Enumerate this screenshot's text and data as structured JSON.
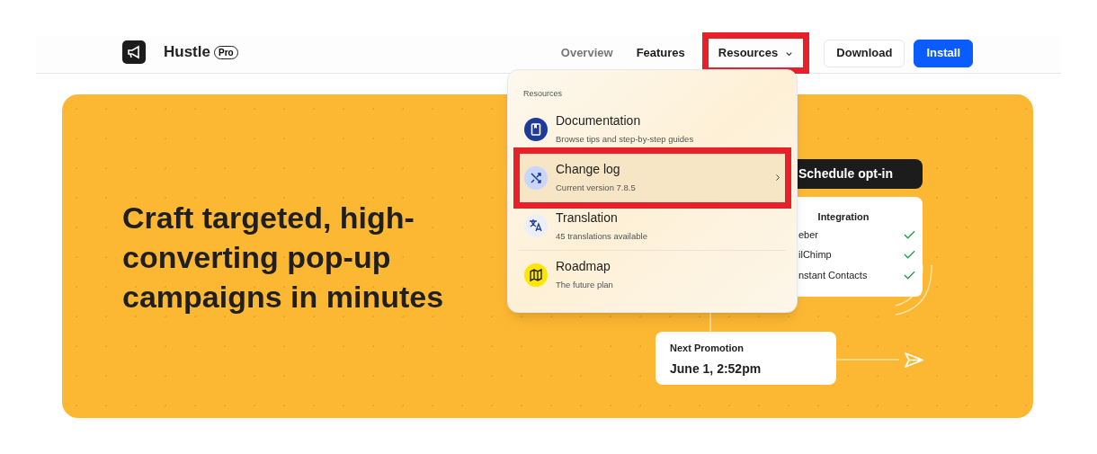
{
  "brand": {
    "name": "Hustle",
    "badge": "Pro"
  },
  "nav": [
    {
      "label": "Overview",
      "selected": false,
      "highlighted": false,
      "dropdown": false
    },
    {
      "label": "Features",
      "selected": true,
      "highlighted": false,
      "dropdown": false
    },
    {
      "label": "Resources",
      "selected": true,
      "highlighted": true,
      "dropdown": true
    }
  ],
  "buttons": [
    {
      "label": "Download",
      "kind": "outline"
    },
    {
      "label": "Install",
      "kind": "primary"
    }
  ],
  "hero": {
    "headline": "Craft targeted, high-converting pop-up campaigns in minutes"
  },
  "menu": {
    "heading": "Resources",
    "items": [
      {
        "kind": "book",
        "title": "Documentation",
        "subtitle": "Browse tips and step-by-step guides",
        "highlighted": false,
        "arrow": false,
        "divider": false
      },
      {
        "kind": "shuffle",
        "title": "Change log",
        "subtitle": "Current version 7.8.5",
        "highlighted": true,
        "arrow": true,
        "divider": false
      },
      {
        "kind": "translate",
        "title": "Translation",
        "subtitle": "45 translations available",
        "highlighted": false,
        "arrow": false,
        "divider": true
      },
      {
        "kind": "map",
        "title": "Roadmap",
        "subtitle": "The future plan",
        "highlighted": false,
        "arrow": false,
        "divider": false
      }
    ]
  },
  "schedule": {
    "label": "Schedule opt-in"
  },
  "integration": {
    "title": "Integration",
    "rows": [
      {
        "name": "eber",
        "checked": true
      },
      {
        "name": "ilChimp",
        "checked": true
      },
      {
        "name": "nstant Contacts",
        "checked": true
      }
    ]
  },
  "promotion": {
    "label": "Next Promotion",
    "value": "June 1, 2:52pm"
  }
}
